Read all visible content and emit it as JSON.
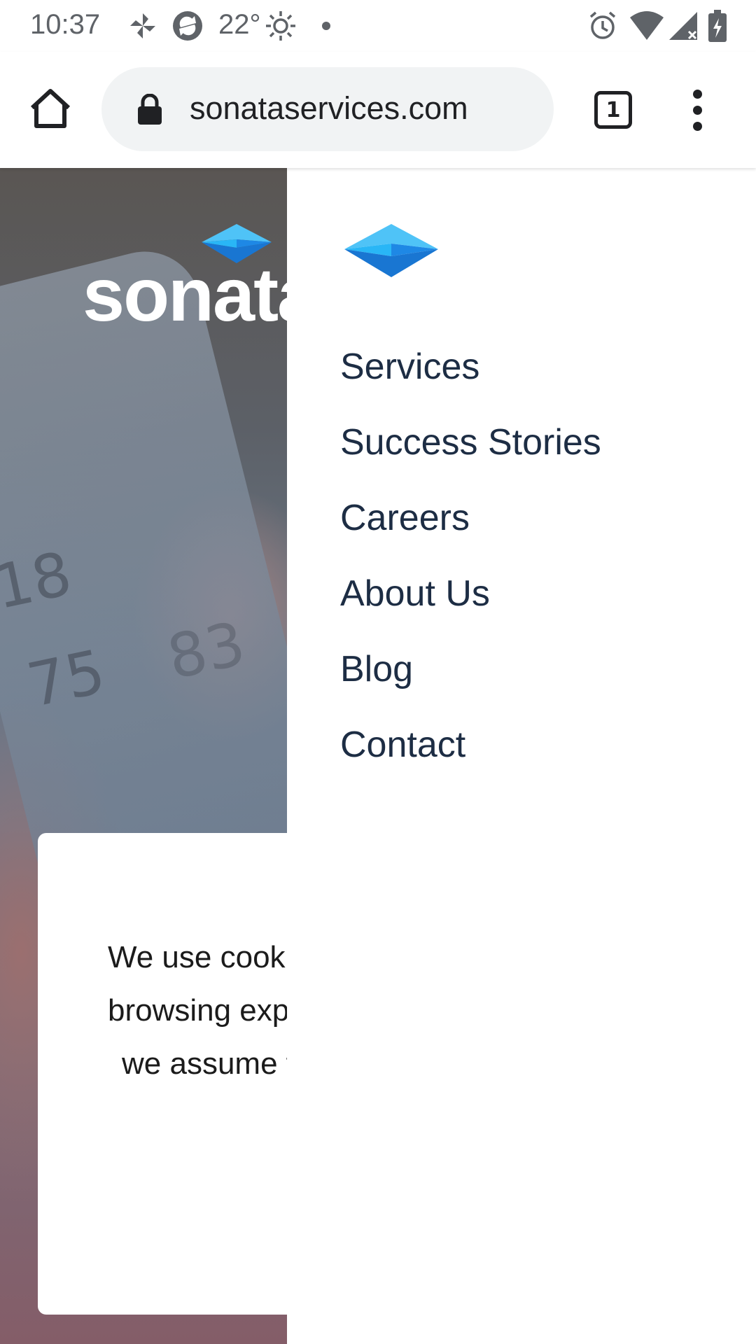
{
  "status_bar": {
    "time": "10:37",
    "temperature": "22°",
    "icons": [
      "pinwheel-icon",
      "sync-app-icon",
      "sun-icon",
      "dot-icon",
      "alarm-icon",
      "wifi-icon",
      "signal-icon",
      "battery-charging-icon"
    ]
  },
  "browser": {
    "url": "sonataservices.com",
    "tab_count": "1",
    "icons": [
      "home-icon",
      "lock-icon",
      "more-vert-icon"
    ]
  },
  "hero": {
    "logo_text": "sonata",
    "reading_1": "18",
    "reading_2": "75",
    "reading_3": "83"
  },
  "drawer": {
    "nav": [
      "Services",
      "Success Stories",
      "Careers",
      "About Us",
      "Blog",
      "Contact"
    ]
  },
  "cookie_banner": {
    "line1": "We use cookies to ensure that we give you the best",
    "line2": "browsing experience on our website. If you continue,",
    "line3": "we assume that you are happy with it."
  },
  "colors": {
    "brand_light_blue": "#4fc3f7",
    "brand_blue": "#1e88e5",
    "nav_text": "#1d2d44"
  }
}
